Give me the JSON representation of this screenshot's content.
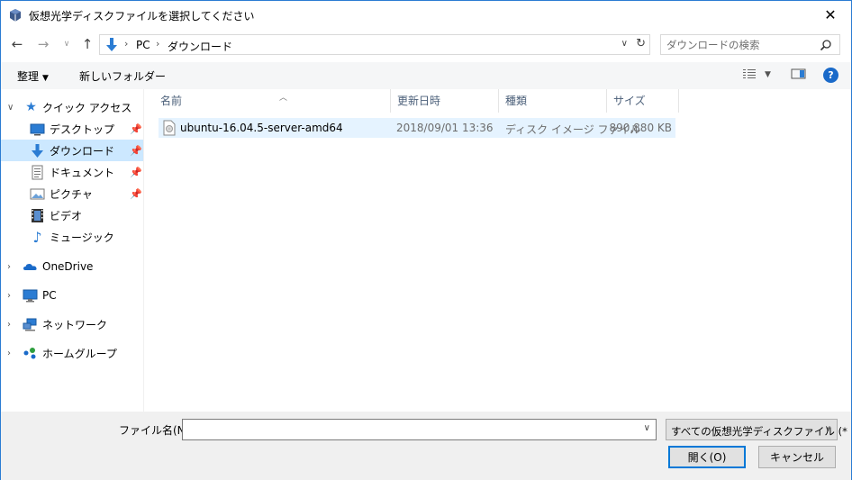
{
  "window": {
    "title": "仮想光学ディスクファイルを選択してください",
    "close_glyph": "✕"
  },
  "address": {
    "crumbs": [
      "PC",
      "ダウンロード"
    ],
    "search_placeholder": "ダウンロードの検索"
  },
  "toolbar": {
    "organize_label": "整理",
    "new_folder_label": "新しいフォルダー"
  },
  "nav": {
    "quick_access": "クイック アクセス",
    "items": [
      {
        "label": "デスクトップ",
        "icon": "desktop-icon",
        "pinned": true
      },
      {
        "label": "ダウンロード",
        "icon": "download-icon",
        "pinned": true,
        "selected": true
      },
      {
        "label": "ドキュメント",
        "icon": "document-icon",
        "pinned": true
      },
      {
        "label": "ピクチャ",
        "icon": "pictures-icon",
        "pinned": true
      },
      {
        "label": "ビデオ",
        "icon": "video-icon",
        "pinned": false
      },
      {
        "label": "ミュージック",
        "icon": "music-icon",
        "pinned": false
      }
    ],
    "roots": [
      {
        "label": "OneDrive",
        "icon": "onedrive-icon"
      },
      {
        "label": "PC",
        "icon": "pc-icon"
      },
      {
        "label": "ネットワーク",
        "icon": "network-icon"
      },
      {
        "label": "ホームグループ",
        "icon": "homegroup-icon"
      }
    ]
  },
  "columns": [
    "名前",
    "更新日時",
    "種類",
    "サイズ"
  ],
  "files": [
    {
      "name": "ubuntu-16.04.5-server-amd64",
      "modified": "2018/09/01 13:36",
      "type": "ディスク イメージ ファイル",
      "size": "890,880 KB"
    }
  ],
  "footer": {
    "filename_label": "ファイル名(N):",
    "filename_value": "",
    "filter_value": "すべての仮想光学ディスクファイル (*",
    "open_label": "開く(O)",
    "cancel_label": "キャンセル"
  },
  "colors": {
    "accent": "#0078d7",
    "selection": "#cce8ff",
    "row_hover": "#e5f3ff"
  }
}
